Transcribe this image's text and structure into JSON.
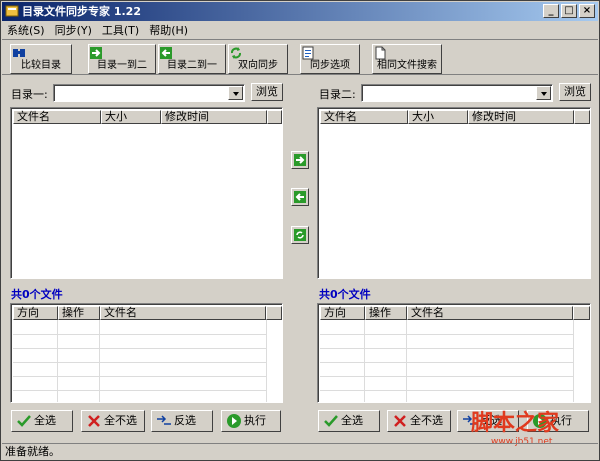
{
  "window": {
    "title": "目录文件同步专家 1.22",
    "minimize": "_",
    "maximize": "□",
    "close": "×"
  },
  "menu": [
    "系统(S)",
    "同步(Y)",
    "工具(T)",
    "帮助(H)"
  ],
  "toolbar": {
    "compare": "比较目录",
    "one_to_two": "目录一到二",
    "two_to_one": "目录二到一",
    "bidirectional": "双向同步",
    "options": "同步选项",
    "same_search": "相同文件搜索"
  },
  "dir1": {
    "label": "目录一:",
    "value": "",
    "browse": "浏览"
  },
  "dir2": {
    "label": "目录二:",
    "value": "",
    "browse": "浏览"
  },
  "file_columns": [
    "文件名",
    "大小",
    "修改时间"
  ],
  "left_count": "共0个文件",
  "right_count": "共0个文件",
  "action_columns": [
    "方向",
    "操作",
    "文件名"
  ],
  "buttons": {
    "select_all": "全选",
    "select_none": "全不选",
    "invert": "反选",
    "execute": "执行"
  },
  "status": "准备就绪。",
  "watermark": {
    "main": "脚本之家",
    "url": "www.jb51.net"
  },
  "colors": {
    "title_start": "#0a246a",
    "title_end": "#a6caf0",
    "count_text": "#0000c0",
    "face": "#d4d0c8"
  }
}
